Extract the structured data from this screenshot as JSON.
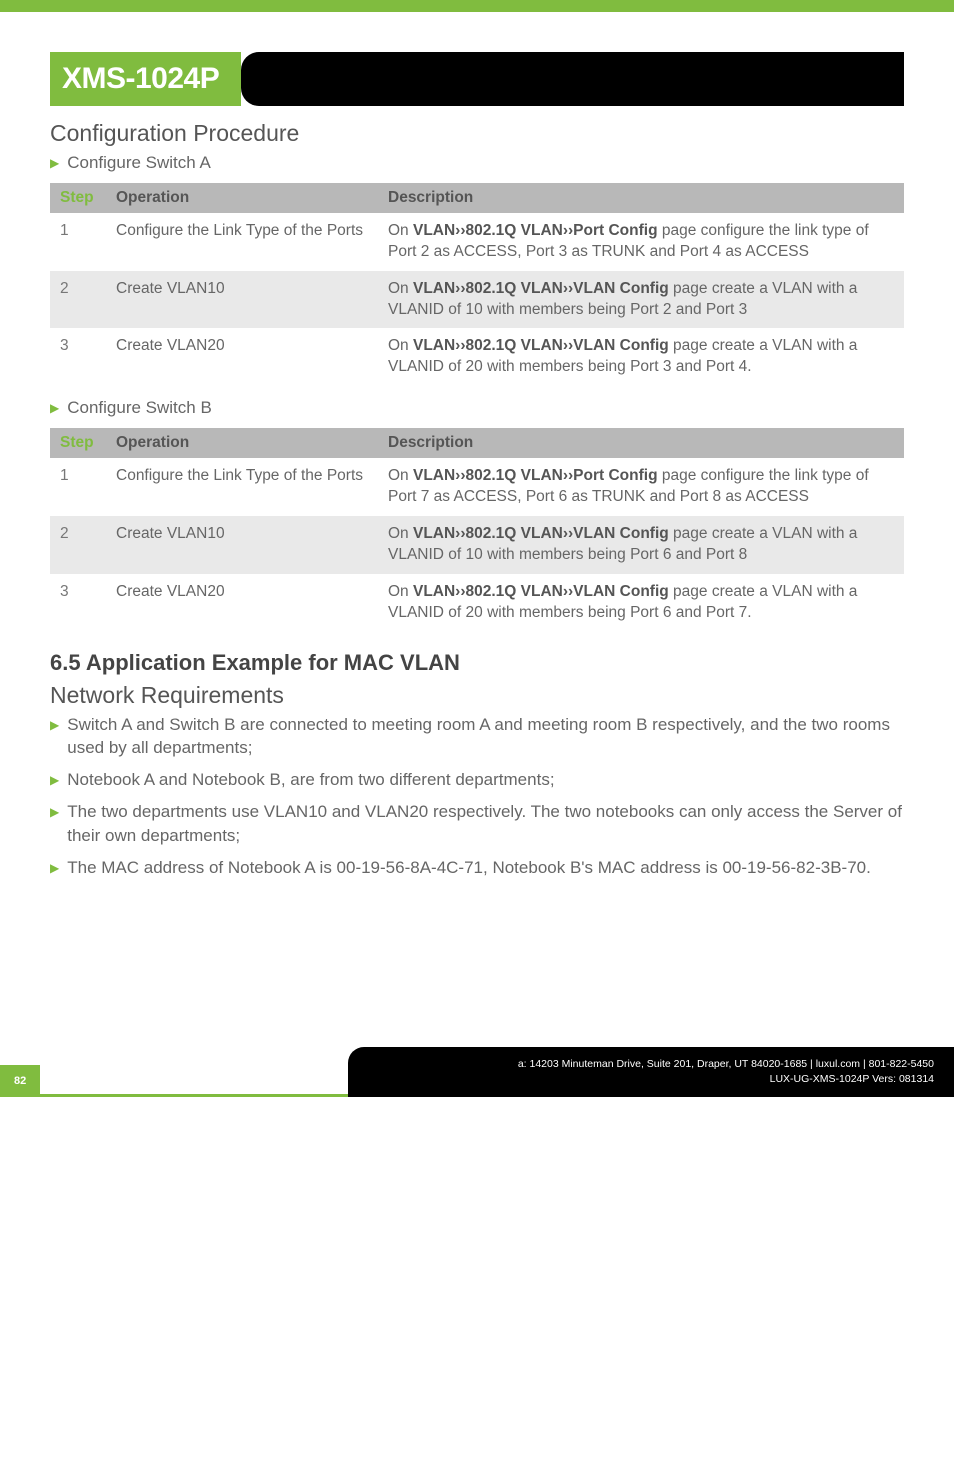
{
  "title": "XMS-1024P",
  "section1_heading": "Configuration Procedure",
  "bullet_switchA": "Configure Switch A",
  "bullet_switchB": "Configure Switch B",
  "table_headers": {
    "step": "Step",
    "operation": "Operation",
    "description": "Description"
  },
  "tableA": [
    {
      "step": "1",
      "op": "Configure the Link Type of the Ports",
      "desc_prefix": "On ",
      "desc_bold": "VLAN››802.1Q VLAN››Port Config",
      "desc_suffix": " page configure the link type of Port 2 as ACCESS, Port 3 as TRUNK and Port 4 as ACCESS"
    },
    {
      "step": "2",
      "op": "Create VLAN10",
      "desc_prefix": "On ",
      "desc_bold": "VLAN››802.1Q VLAN››VLAN Config",
      "desc_suffix": " page create a VLAN with a VLANID of 10 with members being Port 2 and Port 3"
    },
    {
      "step": "3",
      "op": "Create VLAN20",
      "desc_prefix": "On ",
      "desc_bold": "VLAN››802.1Q VLAN››VLAN Config",
      "desc_suffix": " page create a VLAN with a VLANID of 20 with members being Port 3 and Port 4."
    }
  ],
  "tableB": [
    {
      "step": "1",
      "op": "Configure the Link Type of the Ports",
      "desc_prefix": "On ",
      "desc_bold": "VLAN››802.1Q VLAN››Port Config",
      "desc_suffix": " page configure the link type of Port 7 as ACCESS, Port 6 as TRUNK and Port 8 as ACCESS"
    },
    {
      "step": "2",
      "op": "Create VLAN10",
      "desc_prefix": "On ",
      "desc_bold": "VLAN››802.1Q VLAN››VLAN Config",
      "desc_suffix": " page create a VLAN with a VLANID of 10 with members being Port 6 and Port 8"
    },
    {
      "step": "3",
      "op": "Create VLAN20",
      "desc_prefix": "On ",
      "desc_bold": "VLAN››802.1Q VLAN››VLAN Config",
      "desc_suffix": " page create a VLAN with a VLANID of 20 with members being Port 6 and Port 7."
    }
  ],
  "section65_heading": "6.5 Application Example for MAC VLAN",
  "network_req_heading": "Network Requirements",
  "net_bullets": [
    "Switch A and Switch B are connected to meeting room A and meeting room B respectively, and the two rooms used by all departments;",
    "Notebook A and Notebook B, are from two different departments;",
    "The two departments use VLAN10 and VLAN20 respectively. The two notebooks can only access the Server of their own departments;",
    "The MAC address of Notebook A is 00-19-56-8A-4C-71, Notebook B's MAC address is 00-19-56-82-3B-70."
  ],
  "page_number": "82",
  "footer_line1": "a: 14203 Minuteman Drive, Suite 201, Draper, UT 84020-1685 | luxul.com | 801-822-5450",
  "footer_line2": "LUX-UG-XMS-1024P  Vers: 081314"
}
